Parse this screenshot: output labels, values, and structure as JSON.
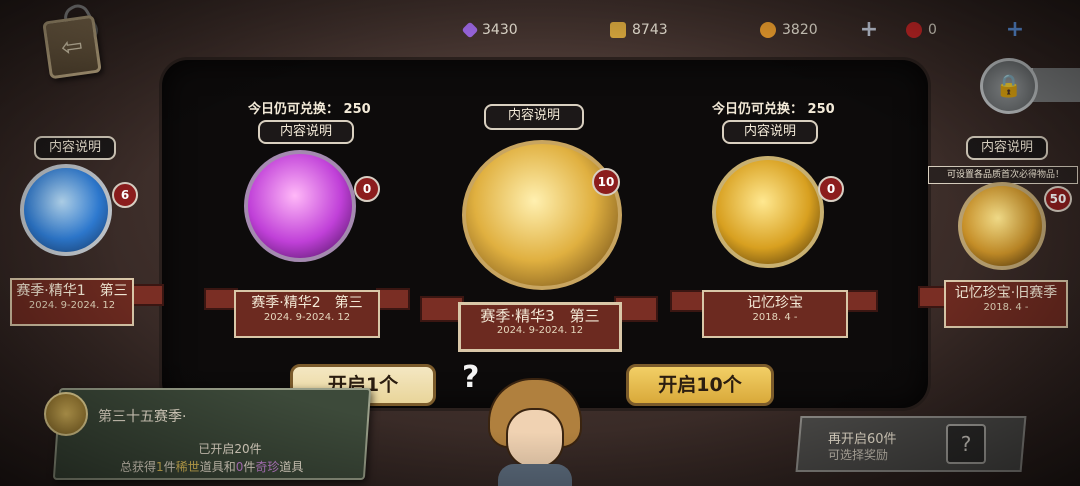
{
  "currencies": [
    {
      "name": "purple-crystal",
      "value": "3430",
      "color": "#a06ae8"
    },
    {
      "name": "puzzle-piece",
      "value": "8743",
      "color": "#d9a83e"
    },
    {
      "name": "gold-coin",
      "value": "3820",
      "color": "#f0a02e"
    },
    {
      "name": "red-token",
      "value": "0",
      "color": "#d02828"
    }
  ],
  "cards": [
    {
      "info": "内容说明",
      "remain": "",
      "count": "6",
      "name": "赛季·精华1　第三",
      "date": "2024. 9-2024. 12",
      "theme": "#4aa2ff"
    },
    {
      "info": "内容说明",
      "remain": "今日仍可兑换： 250",
      "count": "0",
      "name": "赛季·精华2　第三",
      "date": "2024. 9-2024. 12",
      "theme": "#c040d8"
    },
    {
      "info": "内容说明",
      "remain": "",
      "count": "10",
      "name": "赛季·精华3　第三",
      "date": "2024. 9-2024. 12",
      "theme": "#e0b040"
    },
    {
      "info": "内容说明",
      "remain": "今日仍可兑换： 250",
      "count": "0",
      "name": "记忆珍宝",
      "date": "2018. 4 -",
      "theme": "#d8a020"
    },
    {
      "info": "内容说明",
      "remain": "",
      "count": "50",
      "name": "记忆珍宝·旧赛季",
      "date": "2018. 4 -",
      "theme": "#c89028"
    }
  ],
  "tip": "可设置各品质首次必得物品！",
  "buttons": {
    "open_one": "开启1个",
    "open_ten": "开启10个"
  },
  "season": {
    "title": "第三十五赛季·",
    "opened": "已开启20件",
    "summary_prefix": "总获得",
    "rare_count": "1",
    "summary_mid1": "件",
    "rare_label": "稀世",
    "summary_mid2": "道具和",
    "treasure_count": "0",
    "summary_mid3": "件",
    "treasure_label": "奇珍",
    "summary_suffix": "道具"
  },
  "reward": {
    "title": "再开启60件",
    "subtitle": "可选择奖励",
    "box_icon": "?"
  }
}
